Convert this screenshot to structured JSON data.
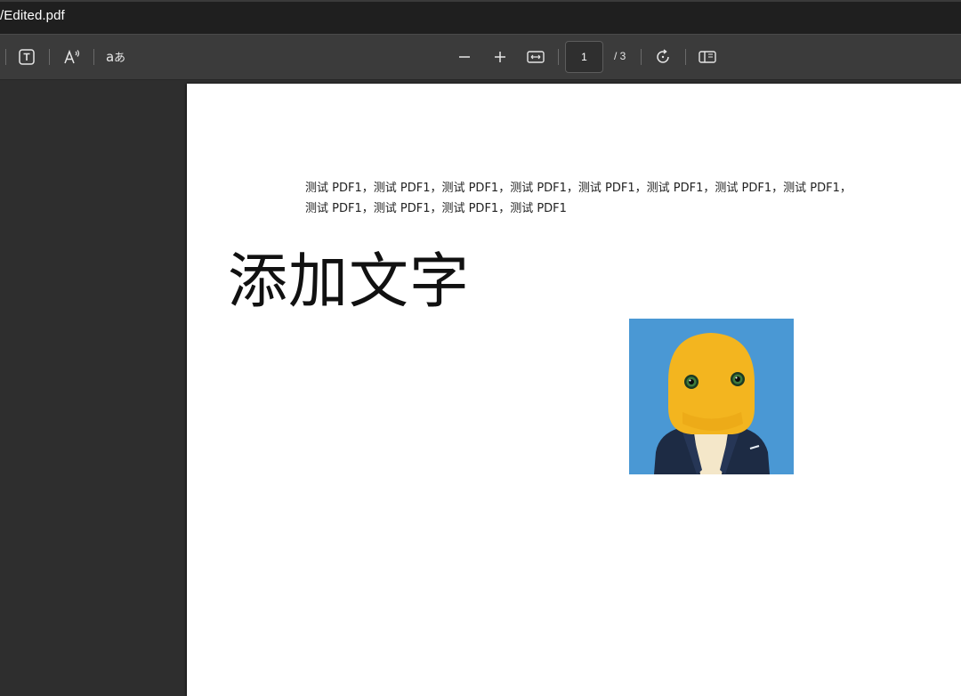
{
  "window": {
    "title": "/Edited.pdf"
  },
  "toolbar": {
    "text_tool_icon": "text-box-icon",
    "read_aloud_icon": "read-aloud-icon",
    "translate_icon": "translate-icon",
    "zoom_out_icon": "minus-icon",
    "zoom_in_icon": "plus-icon",
    "fit_icon": "fit-width-icon",
    "current_page": "1",
    "page_total": "/ 3",
    "rotate_icon": "rotate-icon",
    "page_view_icon": "page-view-icon"
  },
  "document": {
    "paragraph": "测试 PDF1，测试 PDF1，测试 PDF1，测试 PDF1，测试 PDF1，测试 PDF1，测试 PDF1，测试 PDF1，测试 PDF1，测试 PDF1，测试 PDF1，测试 PDF1",
    "heading": "添加文字",
    "image_icon": "yellow-mascot-image"
  },
  "colors": {
    "titlebar": "#1f1f1f",
    "toolbar": "#3b3b3b",
    "viewer_bg": "#2e2e2e",
    "page_bg": "#ffffff",
    "image_bg": "#4a98d4",
    "mascot_yellow": "#f3b51f"
  }
}
